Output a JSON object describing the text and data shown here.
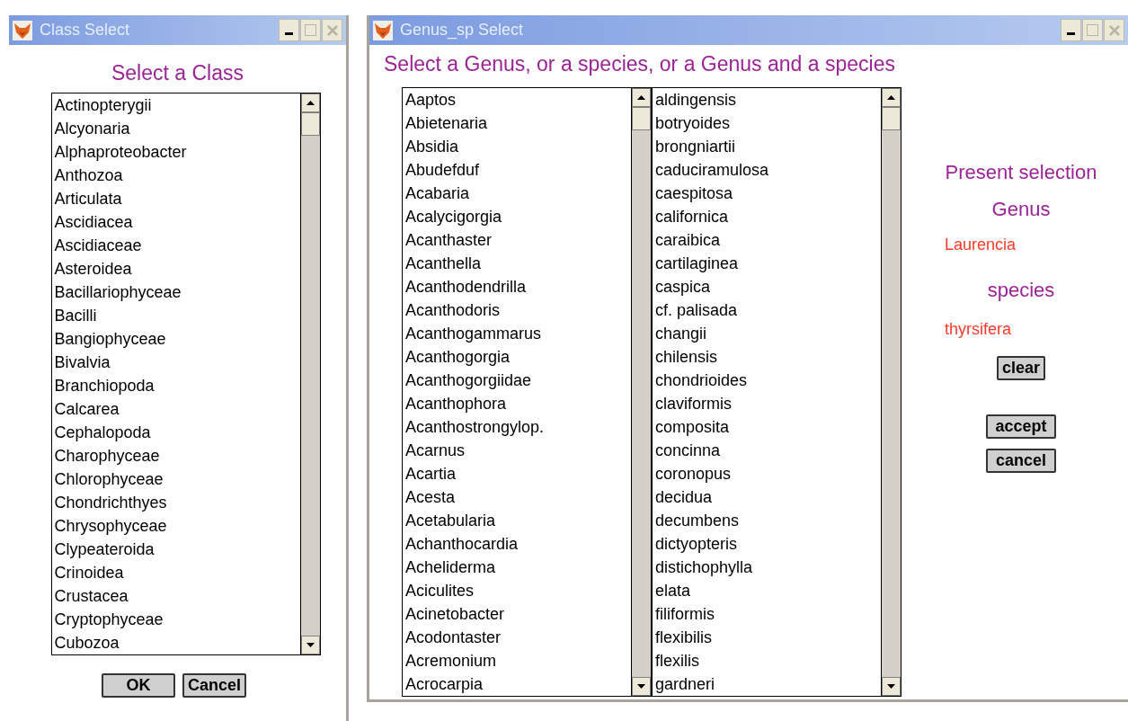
{
  "class_window": {
    "title": "Class Select",
    "heading": "Select a Class",
    "items": [
      "Actinopterygii",
      "Alcyonaria",
      "Alphaproteobacter",
      "Anthozoa",
      "Articulata",
      "Ascidiacea",
      "Ascidiaceae",
      "Asteroidea",
      "Bacillariophyceae",
      "Bacilli",
      "Bangiophyceae",
      "Bivalvia",
      "Branchiopoda",
      "Calcarea",
      "Cephalopoda",
      "Charophyceae",
      "Chlorophyceae",
      "Chondrichthyes",
      "Chrysophyceae",
      "Clypeateroida",
      "Crinoidea",
      "Crustacea",
      "Cryptophyceae",
      "Cubozoa"
    ],
    "buttons": [
      "OK",
      "Cancel"
    ]
  },
  "genus_window": {
    "title": "Genus_sp Select",
    "heading": "Select a Genus, or a species, or a Genus and a species",
    "genus_items": [
      "Aaptos",
      "Abietenaria",
      "Absidia",
      "Abudefduf",
      "Acabaria",
      "Acalycigorgia",
      "Acanthaster",
      "Acanthella",
      "Acanthodendrilla",
      "Acanthodoris",
      "Acanthogammarus",
      "Acanthogorgia",
      "Acanthogorgiidae",
      "Acanthophora",
      "Acanthostrongylop.",
      "Acarnus",
      "Acartia",
      "Acesta",
      "Acetabularia",
      "Achanthocardia",
      "Acheliderma",
      "Aciculites",
      "Acinetobacter",
      "Acodontaster",
      "Acremonium",
      "Acrocarpia"
    ],
    "species_items": [
      "aldingensis",
      "botryoides",
      "brongniartii",
      "caduciramulosa",
      "caespitosa",
      "californica",
      "caraibica",
      "cartilaginea",
      "caspica",
      "cf. palisada",
      "changii",
      "chilensis",
      "chondrioides",
      "claviformis",
      "composita",
      "concinna",
      "coronopus",
      "decidua",
      "decumbens",
      "dictyopteris",
      "distichophylla",
      "elata",
      "filiformis",
      "flexibilis",
      "flexilis",
      "gardneri"
    ],
    "present_selection": {
      "heading": "Present selection",
      "genus_label": "Genus",
      "genus_value": "Laurencia",
      "species_label": "species",
      "species_value": "thyrsifera",
      "clear_button": "clear"
    },
    "buttons": [
      "accept",
      "cancel"
    ]
  }
}
